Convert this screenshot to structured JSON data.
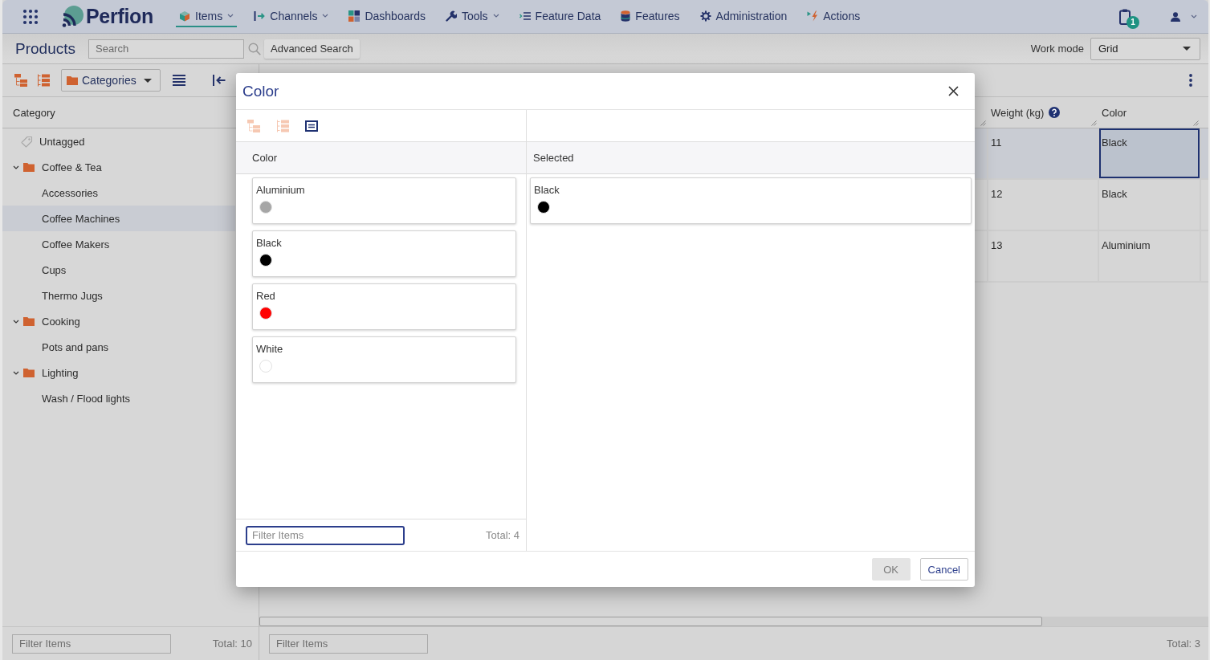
{
  "top_bar": {
    "logo": "Perfion",
    "nav": [
      {
        "label": "Items",
        "selected": true,
        "dropdown": true
      },
      {
        "label": "Channels",
        "selected": false,
        "dropdown": true
      },
      {
        "label": "Dashboards",
        "selected": false,
        "dropdown": false
      },
      {
        "label": "Tools",
        "selected": false,
        "dropdown": true
      },
      {
        "label": "Feature Data",
        "selected": false,
        "dropdown": false
      },
      {
        "label": "Features",
        "selected": false,
        "dropdown": false
      },
      {
        "label": "Administration",
        "selected": false,
        "dropdown": false
      },
      {
        "label": "Actions",
        "selected": false,
        "dropdown": false
      }
    ],
    "notification_count": "1"
  },
  "header": {
    "title": "Products",
    "search": {
      "placeholder": "Search"
    },
    "advanced_search": "Advanced Search",
    "work_mode": {
      "label": "Work mode",
      "value": "Grid"
    }
  },
  "category_panel": {
    "view": "Categories",
    "column": "Category",
    "tree": [
      {
        "label": "Untagged",
        "kind": "untagged",
        "selected": false
      },
      {
        "label": "Coffee & Tea",
        "kind": "folder",
        "selected": false,
        "expanded": true,
        "children": [
          {
            "label": "Accessories",
            "kind": "category",
            "selected": false
          },
          {
            "label": "Coffee Machines",
            "kind": "category",
            "selected": true
          },
          {
            "label": "Coffee Makers",
            "kind": "category",
            "selected": false
          },
          {
            "label": "Cups",
            "kind": "category",
            "selected": false
          },
          {
            "label": "Thermo Jugs",
            "kind": "category",
            "selected": false
          }
        ]
      },
      {
        "label": "Cooking",
        "kind": "folder",
        "selected": false,
        "expanded": true,
        "children": [
          {
            "label": "Pots and pans",
            "kind": "category",
            "selected": false
          }
        ]
      },
      {
        "label": "Lighting",
        "kind": "folder",
        "selected": false,
        "expanded": true,
        "children": [
          {
            "label": "Wash / Flood lights",
            "kind": "category",
            "selected": false
          }
        ]
      }
    ],
    "filter": {
      "placeholder": "Filter Items"
    },
    "total": "Total: 10"
  },
  "grid": {
    "columns": [
      {
        "label": "Weight (kg)",
        "help": true
      },
      {
        "label": "Color",
        "help": false
      }
    ],
    "rows": [
      {
        "selected": true,
        "cells": [
          {
            "text": "11",
            "focused": false
          },
          {
            "text": "Black",
            "focused": true
          }
        ]
      },
      {
        "selected": false,
        "cells": [
          {
            "text": "12",
            "focused": false
          },
          {
            "text": "Black",
            "focused": false
          }
        ]
      },
      {
        "selected": false,
        "cells": [
          {
            "text": "13",
            "focused": false
          },
          {
            "text": "Aluminium",
            "focused": false
          }
        ]
      }
    ],
    "filter": {
      "placeholder": "Filter Items"
    },
    "total": "Total: 3"
  },
  "dialog": {
    "title": "Color",
    "views": [
      {
        "selected": false
      },
      {
        "selected": false
      },
      {
        "selected": true
      }
    ],
    "available": {
      "heading": "Color",
      "options": [
        {
          "label": "Aluminium",
          "color": "#a6a6a6"
        },
        {
          "label": "Black",
          "color": "#000000"
        },
        {
          "label": "Red",
          "color": "#ff0000"
        },
        {
          "label": "White",
          "color": "#ffffff"
        }
      ],
      "filter": {
        "placeholder": "Filter Items",
        "focused": true
      },
      "total": "Total: 4"
    },
    "selected": {
      "heading": "Selected",
      "options": [
        {
          "label": "Black",
          "color": "#000000"
        }
      ]
    },
    "buttons": [
      {
        "label": "OK",
        "disabled": true
      },
      {
        "label": "Cancel",
        "disabled": false
      }
    ]
  }
}
